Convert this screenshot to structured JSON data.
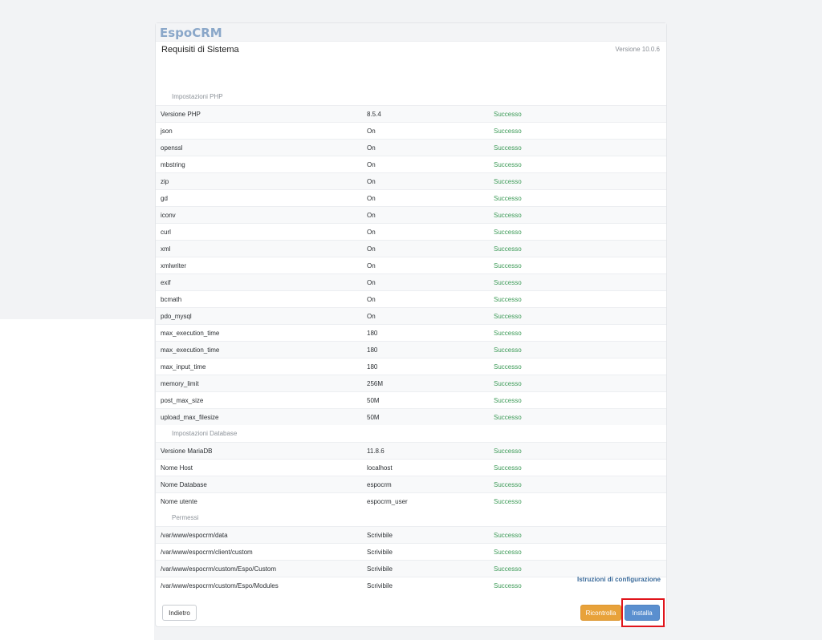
{
  "app": {
    "brand": "EspoCRM",
    "page_title": "Requisiti di Sistema",
    "version": "Versione 10.0.6"
  },
  "sections": [
    {
      "title": "Impostazioni PHP",
      "rows": [
        {
          "name": "Versione PHP",
          "value": "8.5.4",
          "status": "Successo"
        },
        {
          "name": "json",
          "value": "On",
          "status": "Successo"
        },
        {
          "name": "openssl",
          "value": "On",
          "status": "Successo"
        },
        {
          "name": "mbstring",
          "value": "On",
          "status": "Successo"
        },
        {
          "name": "zip",
          "value": "On",
          "status": "Successo"
        },
        {
          "name": "gd",
          "value": "On",
          "status": "Successo"
        },
        {
          "name": "iconv",
          "value": "On",
          "status": "Successo"
        },
        {
          "name": "curl",
          "value": "On",
          "status": "Successo"
        },
        {
          "name": "xml",
          "value": "On",
          "status": "Successo"
        },
        {
          "name": "xmlwriter",
          "value": "On",
          "status": "Successo"
        },
        {
          "name": "exif",
          "value": "On",
          "status": "Successo"
        },
        {
          "name": "bcmath",
          "value": "On",
          "status": "Successo"
        },
        {
          "name": "pdo_mysql",
          "value": "On",
          "status": "Successo"
        },
        {
          "name": "max_execution_time",
          "value": "180",
          "status": "Successo"
        },
        {
          "name": "max_execution_time",
          "value": "180",
          "status": "Successo"
        },
        {
          "name": "max_input_time",
          "value": "180",
          "status": "Successo"
        },
        {
          "name": "memory_limit",
          "value": "256M",
          "status": "Successo"
        },
        {
          "name": "post_max_size",
          "value": "50M",
          "status": "Successo"
        },
        {
          "name": "upload_max_filesize",
          "value": "50M",
          "status": "Successo"
        }
      ]
    },
    {
      "title": "Impostazioni Database",
      "rows": [
        {
          "name": "Versione MariaDB",
          "value": "11.8.6",
          "status": "Successo"
        },
        {
          "name": "Nome Host",
          "value": "localhost",
          "status": "Successo"
        },
        {
          "name": "Nome Database",
          "value": "espocrm",
          "status": "Successo"
        },
        {
          "name": "Nome utente",
          "value": "espocrm_user",
          "status": "Successo"
        }
      ]
    },
    {
      "title": "Permessi",
      "rows": [
        {
          "name": "/var/www/espocrm/data",
          "value": "Scrivibile",
          "status": "Successo"
        },
        {
          "name": "/var/www/espocrm/client/custom",
          "value": "Scrivibile",
          "status": "Successo"
        },
        {
          "name": "/var/www/espocrm/custom/Espo/Custom",
          "value": "Scrivibile",
          "status": "Successo"
        },
        {
          "name": "/var/www/espocrm/custom/Espo/Modules",
          "value": "Scrivibile",
          "status": "Successo"
        }
      ]
    }
  ],
  "links": {
    "config_instructions": "Istruzioni di configurazione"
  },
  "buttons": {
    "back": "Indietro",
    "recheck": "Ricontrolla",
    "install": "Installa"
  },
  "colors": {
    "success": "#3b9a56",
    "recheck": "#e8a23a",
    "install": "#5a8fcf",
    "highlight": "#e0141b"
  }
}
